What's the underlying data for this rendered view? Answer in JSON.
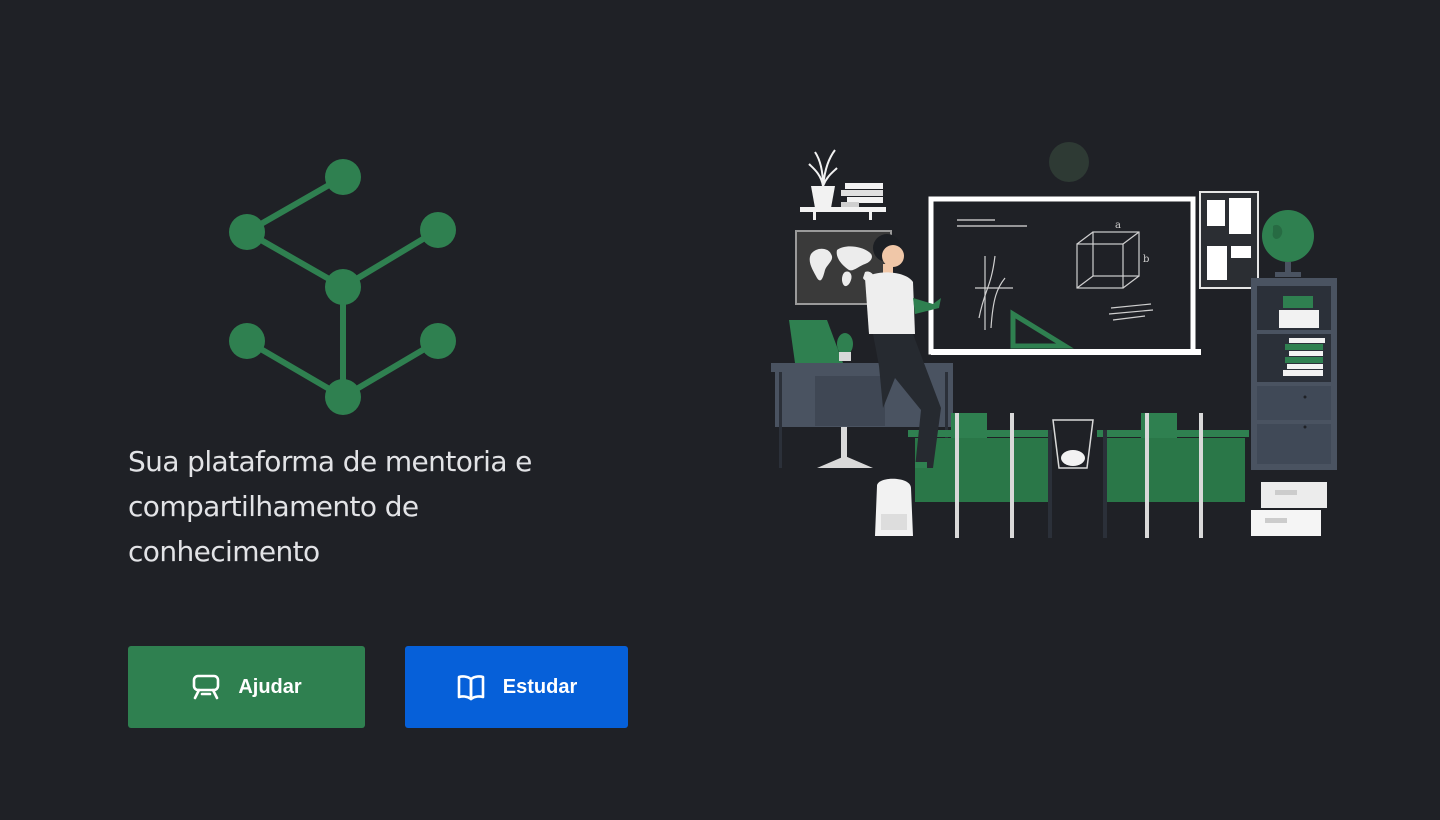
{
  "tagline": "Sua plataforma de mentoria e compartilhamento de conhecimento",
  "buttons": {
    "help": {
      "label": "Ajudar",
      "icon": "presentation-board-icon"
    },
    "study": {
      "label": "Estudar",
      "icon": "open-book-icon"
    }
  },
  "colors": {
    "background": "#1f2126",
    "brand_green": "#2f8050",
    "accent_blue": "#0660d9",
    "text": "#e2e3e6"
  },
  "logo": {
    "icon": "tree-network-icon"
  },
  "illustration": {
    "icon": "classroom-teacher-illustration"
  }
}
